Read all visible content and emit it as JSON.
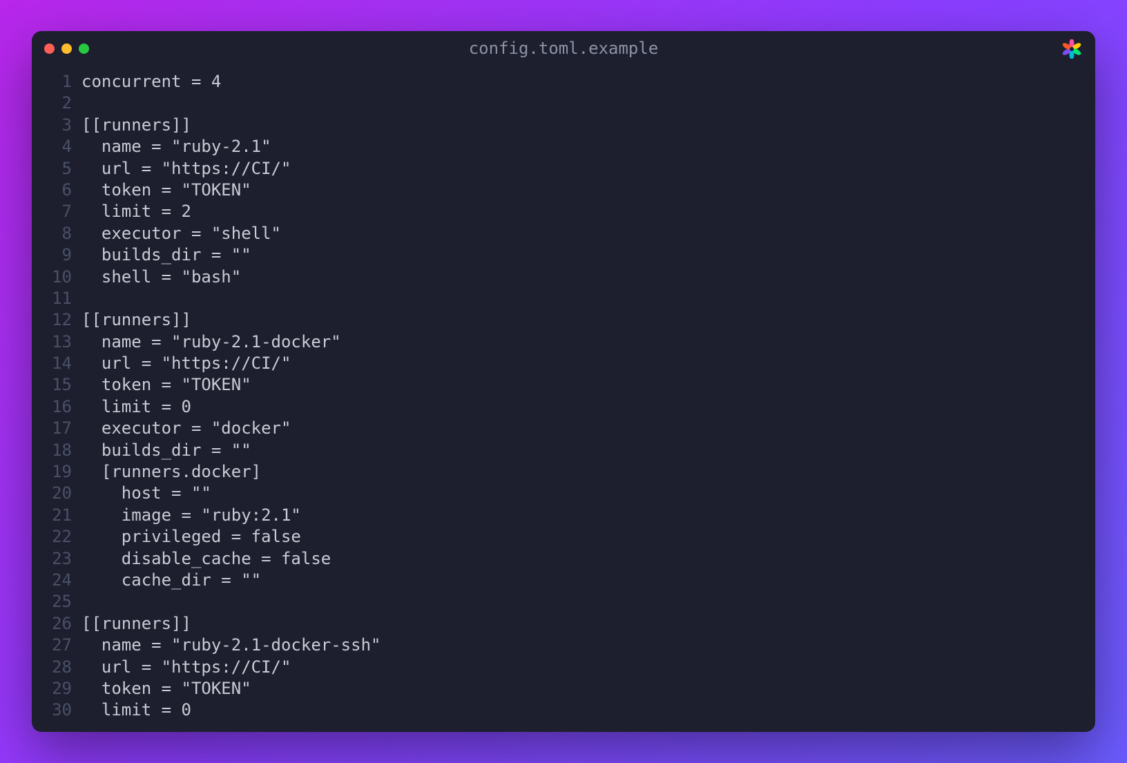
{
  "window": {
    "title": "config.toml.example"
  },
  "code": {
    "lines": [
      "concurrent = 4",
      "",
      "[[runners]]",
      "  name = \"ruby-2.1\"",
      "  url = \"https://CI/\"",
      "  token = \"TOKEN\"",
      "  limit = 2",
      "  executor = \"shell\"",
      "  builds_dir = \"\"",
      "  shell = \"bash\"",
      "",
      "[[runners]]",
      "  name = \"ruby-2.1-docker\"",
      "  url = \"https://CI/\"",
      "  token = \"TOKEN\"",
      "  limit = 0",
      "  executor = \"docker\"",
      "  builds_dir = \"\"",
      "  [runners.docker]",
      "    host = \"\"",
      "    image = \"ruby:2.1\"",
      "    privileged = false",
      "    disable_cache = false",
      "    cache_dir = \"\"",
      "",
      "[[runners]]",
      "  name = \"ruby-2.1-docker-ssh\"",
      "  url = \"https://CI/\"",
      "  token = \"TOKEN\"",
      "  limit = 0"
    ]
  }
}
